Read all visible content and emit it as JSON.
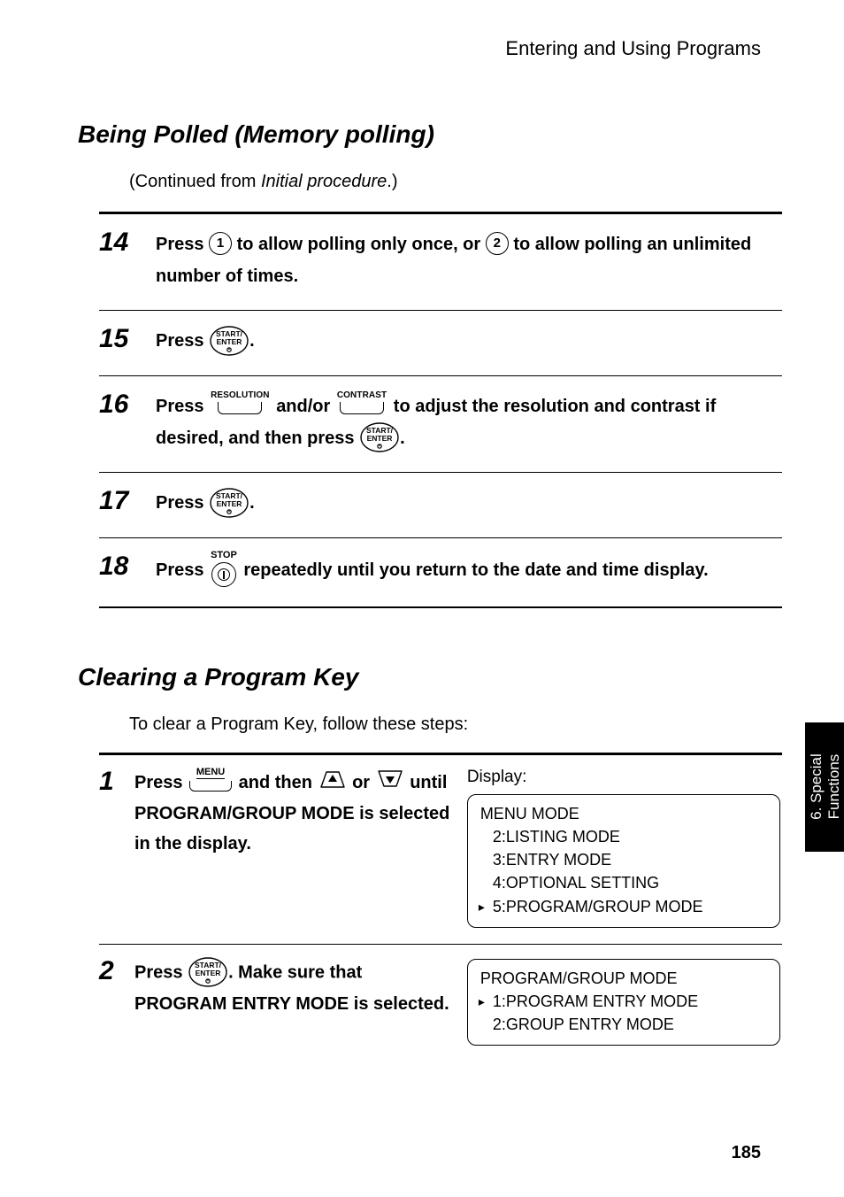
{
  "header": {
    "section": "Entering and Using Programs"
  },
  "section1": {
    "title": "Being Polled (Memory polling)",
    "continued_prefix": "(Continued from ",
    "continued_ital": "Initial procedure",
    "continued_suffix": ".)",
    "steps": {
      "s14": {
        "num": "14",
        "a": "Press ",
        "b": " to allow polling only once, or ",
        "c": " to allow polling an unlimited number of times."
      },
      "s15": {
        "num": "15",
        "a": "Press ",
        "b": "."
      },
      "s16": {
        "num": "16",
        "a": "Press ",
        "b": " and/or ",
        "c": " to adjust the resolution and contrast if desired, and then press ",
        "d": "."
      },
      "s17": {
        "num": "17",
        "a": "Press ",
        "b": "."
      },
      "s18": {
        "num": "18",
        "a": "Press ",
        "b": " repeatedly until you return to the date and time display."
      }
    }
  },
  "keys": {
    "resolution": "RESOLUTION",
    "contrast": "CONTRAST",
    "stop": "STOP",
    "menu": "MENU",
    "circle1": "1",
    "circle2": "2"
  },
  "section2": {
    "title": "Clearing a Program Key",
    "intro": "To clear a Program Key, follow these steps:",
    "display_label": "Display:",
    "steps": {
      "s1": {
        "num": "1",
        "a": "Press ",
        "b": " and then ",
        "c": " or ",
        "d": " until PROGRAM/GROUP MODE is selected in the display.",
        "box": {
          "l1": "MENU MODE",
          "l2": "2:LISTING MODE",
          "l3": "3:ENTRY MODE",
          "l4": "4:OPTIONAL SETTING",
          "l5": "5:PROGRAM/GROUP MODE"
        }
      },
      "s2": {
        "num": "2",
        "a": "Press ",
        "b": ". Make sure that PROGRAM ENTRY MODE is selected.",
        "box": {
          "l1": "PROGRAM/GROUP MODE",
          "l2": "1:PROGRAM ENTRY MODE",
          "l3": "2:GROUP ENTRY MODE"
        }
      }
    }
  },
  "sidetab": "6. Special\nFunctions",
  "page_number": "185"
}
